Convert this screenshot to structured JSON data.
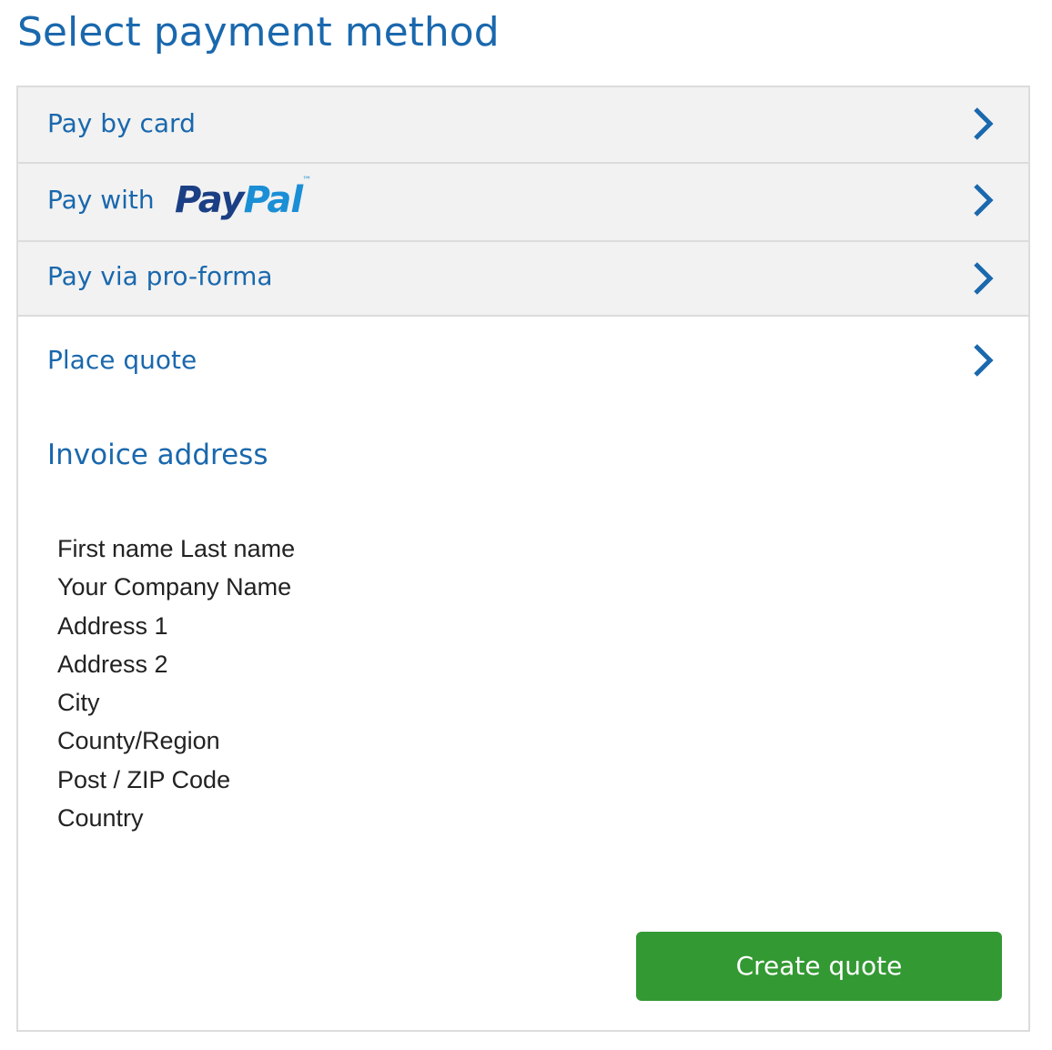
{
  "page": {
    "title": "Select payment method"
  },
  "colors": {
    "accent": "#1a68ad",
    "panel_background": "#f2f2f2",
    "border": "#dcdcdc",
    "button": "#339933",
    "button_text": "#ffffff",
    "paypal_dark": "#1b3f84",
    "paypal_light": "#1b8fd6"
  },
  "payment_options": [
    {
      "label": "Pay by card",
      "icon": "chevron-right-icon"
    },
    {
      "label": "Pay with",
      "logo_text_pay": "Pay",
      "logo_text_pal": "Pal",
      "icon": "chevron-right-icon"
    },
    {
      "label": "Pay via pro-forma",
      "icon": "chevron-right-icon"
    },
    {
      "label": "Place quote",
      "icon": "chevron-right-icon",
      "expanded": true
    }
  ],
  "quote": {
    "section_heading": "Invoice address",
    "address_lines": [
      "First name Last name",
      "Your Company Name",
      "Address 1",
      "Address 2",
      "City",
      "County/Region",
      "Post / ZIP Code",
      "Country"
    ],
    "submit_label": "Create quote"
  }
}
